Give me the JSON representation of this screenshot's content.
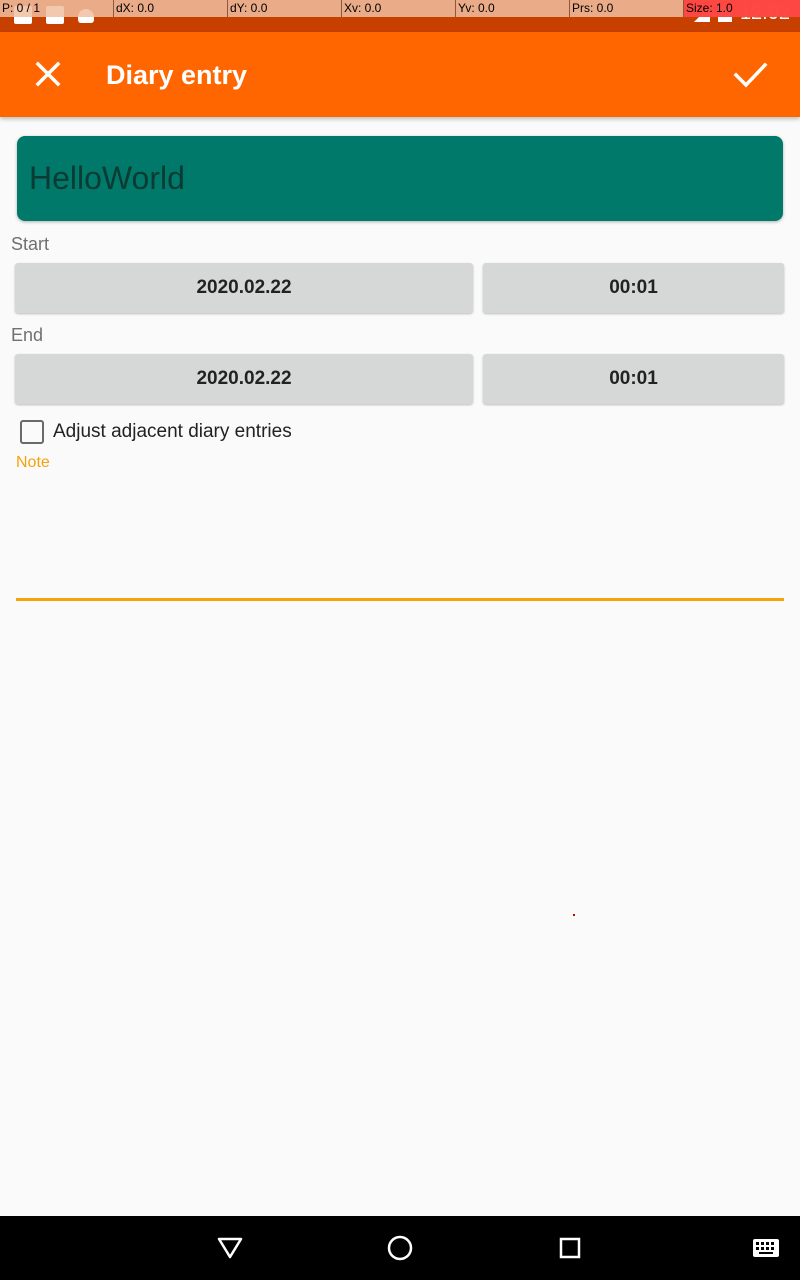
{
  "status_bar": {
    "time": "12:02",
    "icons": [
      "notification-square-icon",
      "notification-square-icon",
      "android-icon",
      "signal-icon",
      "battery-icon"
    ]
  },
  "pointer_overlay": {
    "p": "P: 0 / 1",
    "dx": "dX: 0.0",
    "dy": "dY: 0.0",
    "xv": "Xv: 0.0",
    "yv": "Yv: 0.0",
    "prs": "Prs: 0.0",
    "size": "Size: 1.0"
  },
  "app_bar": {
    "title": "Diary entry",
    "close_icon": "close-icon",
    "confirm_icon": "check-icon",
    "color": "#ff6600"
  },
  "activity": {
    "name": "HelloWorld",
    "color": "#00796b"
  },
  "start": {
    "label": "Start",
    "date": "2020.02.22",
    "time": "00:01"
  },
  "end": {
    "label": "End",
    "date": "2020.02.22",
    "time": "00:01"
  },
  "adjust": {
    "label": "Adjust adjacent diary entries",
    "checked": false
  },
  "note": {
    "label": "Note",
    "value": "",
    "accent": "#f5a30a"
  },
  "nav_bar": {
    "icons": [
      "back-icon",
      "home-icon",
      "recents-icon",
      "keyboard-icon"
    ]
  }
}
